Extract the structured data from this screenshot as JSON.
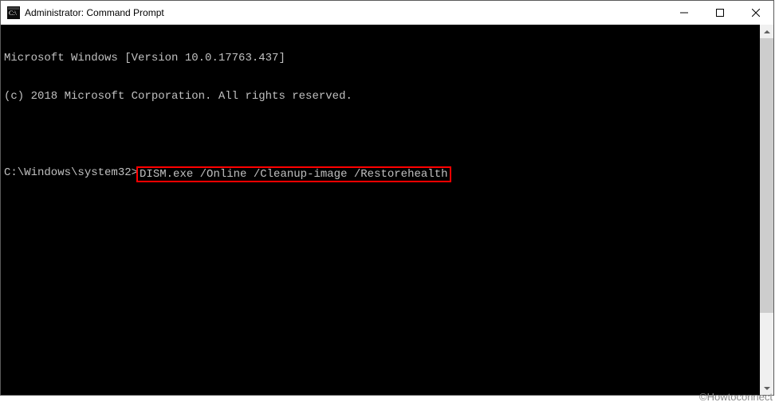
{
  "window": {
    "title": "Administrator: Command Prompt"
  },
  "console": {
    "line1": "Microsoft Windows [Version 10.0.17763.437]",
    "line2": "(c) 2018 Microsoft Corporation. All rights reserved.",
    "blank": "",
    "prompt": "C:\\Windows\\system32>",
    "command": "DISM.exe /Online /Cleanup-image /Restorehealth"
  },
  "watermark": "©Howtoconnect"
}
